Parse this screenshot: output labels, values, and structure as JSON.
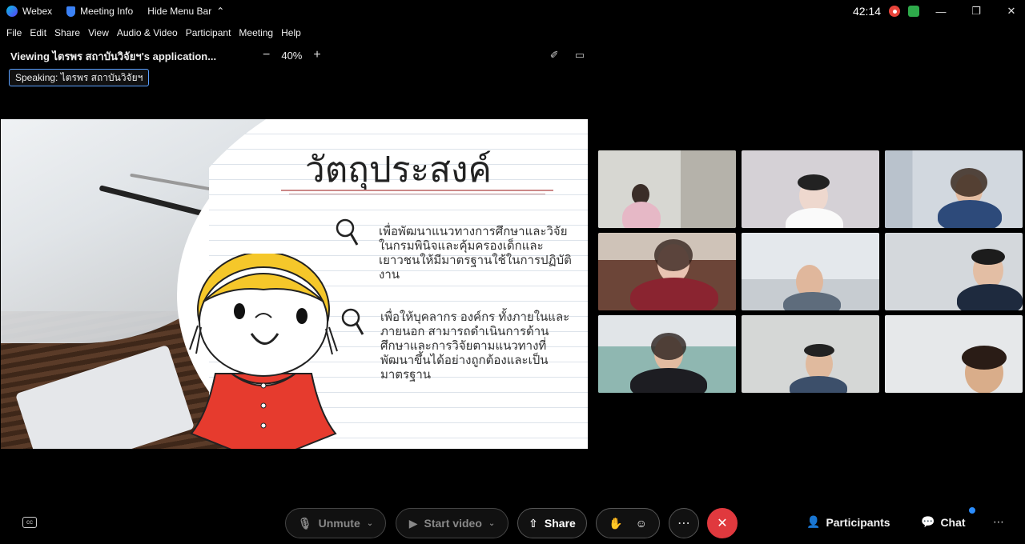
{
  "titlebar": {
    "app_name": "Webex",
    "meeting_info": "Meeting Info",
    "hide_menu": "Hide Menu Bar",
    "timer": "42:14",
    "colors": {
      "record": "#e8443a",
      "network": "#2eaa4a"
    }
  },
  "menu": {
    "items": [
      "File",
      "Edit",
      "Share",
      "View",
      "Audio & Video",
      "Participant",
      "Meeting",
      "Help"
    ]
  },
  "viewing": {
    "label": "Viewing ไตรพร สถาบันวิจัยฯ's application...",
    "zoom": "40%"
  },
  "speaking": "Speaking: ไตรพร สถาบันวิจัยฯ",
  "slide": {
    "title": "วัตถุประสงค์",
    "bullet1": "เพื่อพัฒนาแนวทางการศึกษาและวิจัยในกรมพินิจและคุ้มครองเด็กและเยาวชนให้มีมาตรฐานใช้ในการปฏิบัติงาน",
    "bullet2": "เพื่อให้บุคลากร องค์กร ทั้งภายในและภายนอก สามารถดำเนินการด้านศึกษาและการวิจัยตามแนวทางที่พัฒนาขึ้นได้อย่างถูกต้องและเป็นมาตรฐาน"
  },
  "toolbar": {
    "unmute": "Unmute",
    "start_video": "Start video",
    "share": "Share",
    "participants": "Participants",
    "chat": "Chat",
    "leave_color": "#e0393e"
  }
}
